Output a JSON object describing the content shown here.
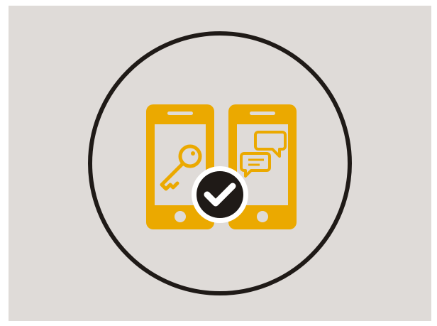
{
  "illustration": {
    "colors": {
      "background": "#dfdbd8",
      "ring": "#1f1a17",
      "phone": "#eba900",
      "screen": "#dfdbd8",
      "badge": "#1f1a17",
      "badge_border": "#ffffff",
      "check": "#ffffff"
    },
    "icons": [
      "phone-icon",
      "key-icon",
      "chat-bubbles-icon",
      "checkmark-icon"
    ]
  }
}
